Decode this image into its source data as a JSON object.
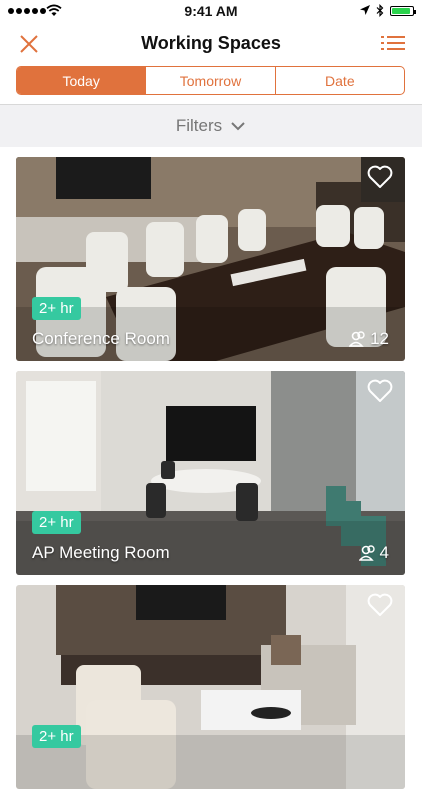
{
  "status": {
    "time": "9:41 AM",
    "battery_level": 0.9
  },
  "nav": {
    "title": "Working Spaces",
    "left_icon": "close-icon",
    "right_icon": "list-icon"
  },
  "segments": [
    {
      "label": "Today",
      "active": true
    },
    {
      "label": "Tomorrow",
      "active": false
    },
    {
      "label": "Date",
      "active": false
    }
  ],
  "filters": {
    "label": "Filters",
    "icon": "chevron-down-icon"
  },
  "rooms": [
    {
      "name": "Conference Room",
      "duration": "2+ hr",
      "capacity": "12"
    },
    {
      "name": "AP Meeting Room",
      "duration": "2+ hr",
      "capacity": "4"
    },
    {
      "name": "",
      "duration": "2+ hr",
      "capacity": ""
    }
  ],
  "colors": {
    "accent": "#e0723d",
    "badge": "#35c9a0",
    "filters_bg": "#f1f1f3"
  }
}
